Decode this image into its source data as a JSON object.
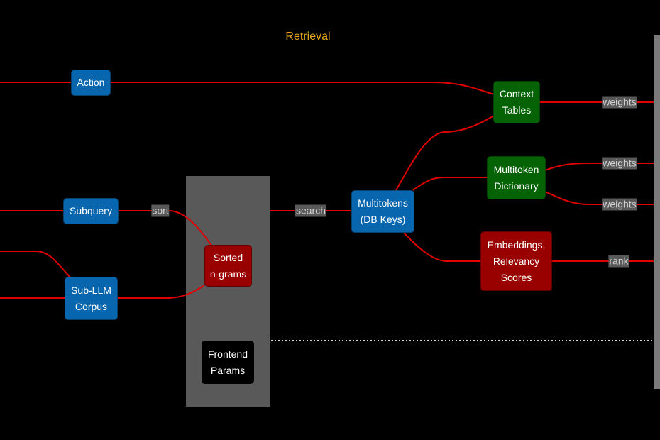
{
  "title": "Retrieval",
  "colors": {
    "edge": "#e00000",
    "node_blue": "#0766ad",
    "node_green": "#056305",
    "node_red": "#990000",
    "cluster": "#595959",
    "title": "#e6a817"
  },
  "nodes": {
    "action": "Action",
    "subquery": "Subquery",
    "sub_llm_corpus": "Sub-LLM\nCorpus",
    "sorted_ngrams": "Sorted\nn-grams",
    "frontend_params": "Frontend\nParams",
    "multitokens": "Multitokens\n(DB Keys)",
    "context_tables": "Context\nTables",
    "multitoken_dictionary": "Multitoken\nDictionary",
    "embeddings": "Embeddings,\nRelevancy\nScores"
  },
  "edge_labels": {
    "sort": "sort",
    "search": "search",
    "weights_context": "weights",
    "weights_dict_1": "weights",
    "weights_dict_2": "weights",
    "rank": "rank"
  }
}
